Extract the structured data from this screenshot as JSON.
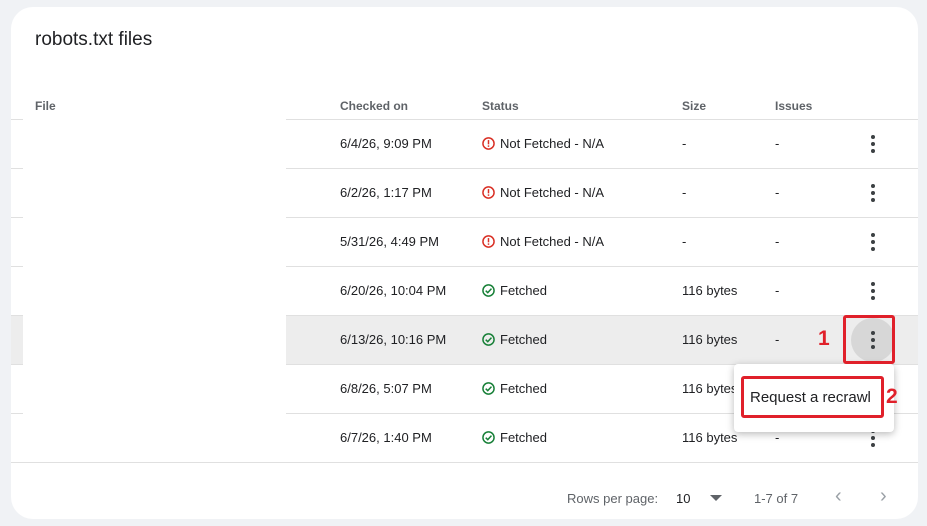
{
  "card": {
    "title": "robots.txt files"
  },
  "table": {
    "columns": {
      "file": "File",
      "checked_on": "Checked on",
      "status": "Status",
      "size": "Size",
      "issues": "Issues"
    },
    "rows": [
      {
        "checked_on": "6/4/26, 9:09 PM",
        "status": "Not Fetched - N/A",
        "status_kind": "error",
        "size": "-",
        "issues": "-"
      },
      {
        "checked_on": "6/2/26, 1:17 PM",
        "status": "Not Fetched - N/A",
        "status_kind": "error",
        "size": "-",
        "issues": "-"
      },
      {
        "checked_on": "5/31/26, 4:49 PM",
        "status": "Not Fetched - N/A",
        "status_kind": "error",
        "size": "-",
        "issues": "-"
      },
      {
        "checked_on": "6/20/26, 10:04 PM",
        "status": "Fetched",
        "status_kind": "ok",
        "size": "116 bytes",
        "issues": "-"
      },
      {
        "checked_on": "6/13/26, 10:16 PM",
        "status": "Fetched",
        "status_kind": "ok",
        "size": "116 bytes",
        "issues": "-"
      },
      {
        "checked_on": "6/8/26, 5:07 PM",
        "status": "Fetched",
        "status_kind": "ok",
        "size": "116 bytes",
        "issues": "-"
      },
      {
        "checked_on": "6/7/26, 1:40 PM",
        "status": "Fetched",
        "status_kind": "ok",
        "size": "116 bytes",
        "issues": "-"
      }
    ],
    "row_action_icon": "more-vert-icon"
  },
  "footer": {
    "rows_per_page_label": "Rows per page:",
    "rows_per_page_value": "10",
    "range": "1-7 of 7"
  },
  "menu": {
    "request_recrawl": "Request a recrawl"
  },
  "annotations": {
    "step1": "1",
    "step2": "2"
  },
  "colors": {
    "error": "#d93025",
    "ok": "#188038",
    "annotation": "#e0202a"
  }
}
